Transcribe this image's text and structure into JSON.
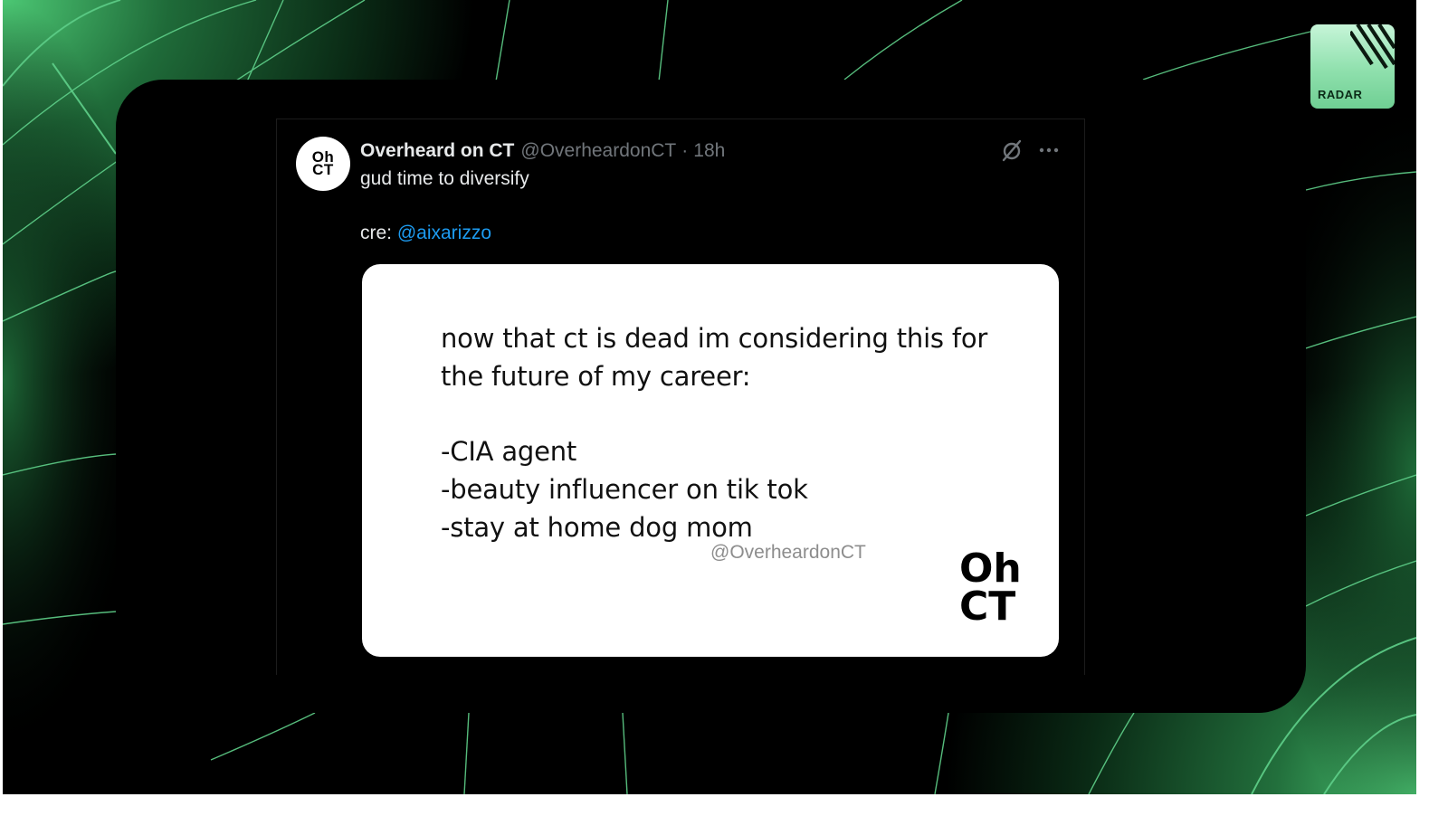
{
  "tweet": {
    "avatar_line1": "Oh",
    "avatar_line2": "CT",
    "display_name": "Overheard on CT",
    "handle": "@OverheardonCT",
    "separator": "·",
    "time": "18h",
    "text": "gud time to diversify",
    "credit_prefix": "cre: ",
    "credit_mention": "@aixarizzo",
    "icons": {
      "grok": "grok-icon",
      "more": "more-options-icon"
    }
  },
  "media": {
    "text": "now that ct is dead im considering this for\nthe future of my career:\n\n-CIA agent\n-beauty influencer on tik tok\n-stay at home dog mom",
    "watermark": "@OverheardonCT",
    "logo_line1": "Oh",
    "logo_line2": "CT"
  },
  "badge": {
    "label": "RADAR"
  },
  "colors": {
    "background": "#000000",
    "accent_green": "#3fbf6a",
    "mention_blue": "#1d9bf0",
    "muted_text": "#71767b"
  }
}
